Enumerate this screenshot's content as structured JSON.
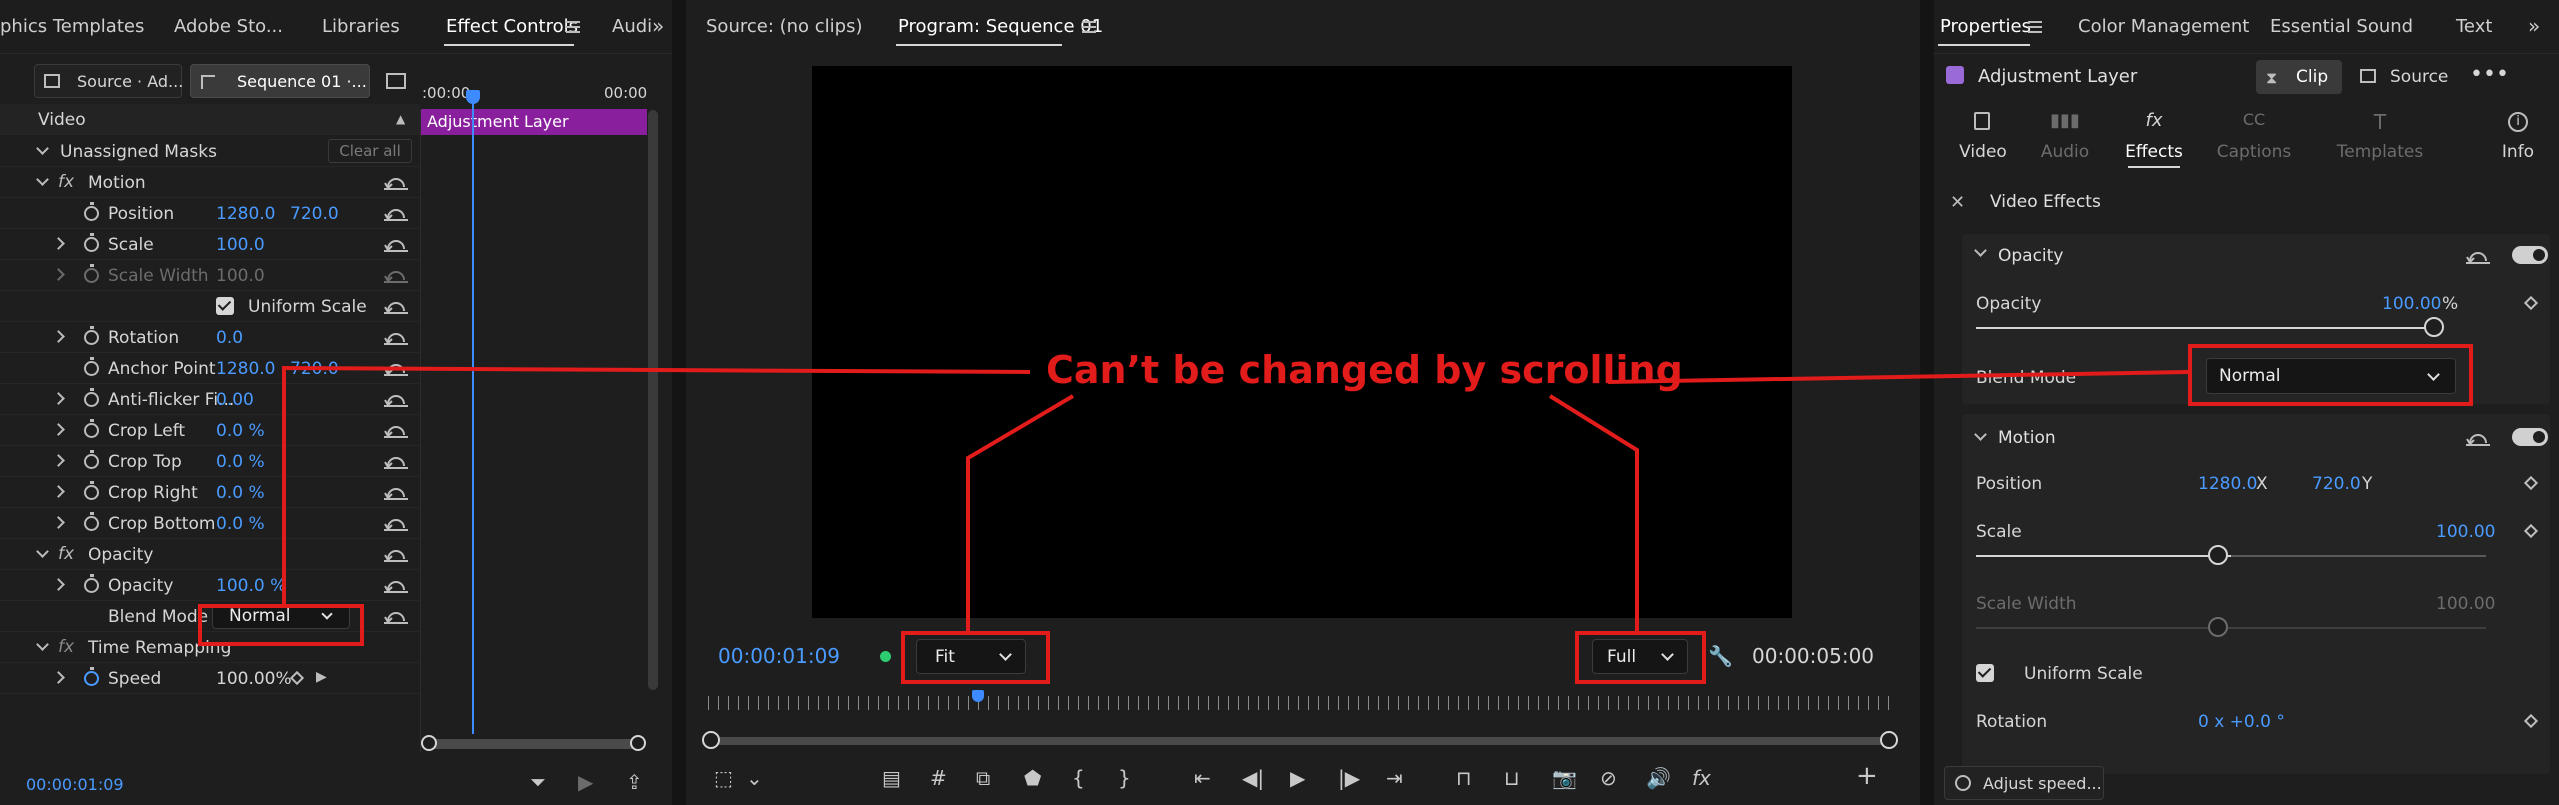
{
  "left_panel": {
    "tabs": [
      "phics Templates",
      "Adobe Sto...",
      "Libraries",
      "Effect Controls",
      "Audi"
    ],
    "source_chip": "Source · Ad...",
    "sequence_chip": "Sequence 01 ·...",
    "timeline_start": ":00:00",
    "timeline_end": "00:00",
    "clip_label": "Adjustment Layer",
    "video_header": "Video",
    "unassigned_masks": "Unassigned Masks",
    "clear_all": "Clear all",
    "motion": "Motion",
    "position": {
      "label": "Position",
      "x": "1280.0",
      "y": "720.0"
    },
    "scale": {
      "label": "Scale",
      "value": "100.0"
    },
    "scale_width": {
      "label": "Scale Width",
      "value": "100.0"
    },
    "uniform_scale": "Uniform Scale",
    "rotation": {
      "label": "Rotation",
      "value": "0.0"
    },
    "anchor_point": {
      "label": "Anchor Point",
      "x": "1280.0",
      "y": "720.0"
    },
    "anti_flicker": {
      "label": "Anti-flicker Fi...",
      "value": "0.00"
    },
    "crop_left": {
      "label": "Crop Left",
      "value": "0.0 %"
    },
    "crop_top": {
      "label": "Crop Top",
      "value": "0.0 %"
    },
    "crop_right": {
      "label": "Crop Right",
      "value": "0.0 %"
    },
    "crop_bottom": {
      "label": "Crop Bottom",
      "value": "0.0 %"
    },
    "opacity_group": "Opacity",
    "opacity": {
      "label": "Opacity",
      "value": "100.0 %"
    },
    "blend_mode": {
      "label": "Blend Mode",
      "value": "Normal"
    },
    "time_remapping": "Time Remapping",
    "speed": {
      "label": "Speed",
      "value": "100.00%"
    },
    "timecode": "00:00:01:09"
  },
  "monitor": {
    "source_tab": "Source: (no clips)",
    "program_tab": "Program: Sequence 01",
    "current_time": "00:00:01:09",
    "fit": "Fit",
    "quality": "Full",
    "duration": "00:00:05:00"
  },
  "annotation": {
    "text": "Can’t be changed by scrolling"
  },
  "right_panel": {
    "tabs": [
      "Properties",
      "Color Management",
      "Essential Sound",
      "Text"
    ],
    "title": "Adjustment Layer",
    "clip_button": "Clip",
    "source_button": "Source",
    "subtabs": [
      "Video",
      "Audio",
      "Effects",
      "Captions",
      "Templates",
      "Info"
    ],
    "video_effects": "Video Effects",
    "opacity_section": "Opacity",
    "opacity": {
      "label": "Opacity",
      "value": "100.00",
      "unit": "%"
    },
    "blend_mode": {
      "label": "Blend Mode",
      "value": "Normal"
    },
    "motion_section": "Motion",
    "position": {
      "label": "Position",
      "x": "1280.0",
      "x_axis": "X",
      "y": "720.0",
      "y_axis": "Y"
    },
    "scale": {
      "label": "Scale",
      "value": "100.00"
    },
    "scale_width": {
      "label": "Scale Width",
      "value": "100.00"
    },
    "uniform_scale": "Uniform Scale",
    "rotation": {
      "label": "Rotation",
      "value": "0 x +0.0 °"
    },
    "adjust_speed": "Adjust speed..."
  },
  "colors": {
    "accent": "#4a9bff",
    "annotation": "#e21b1b",
    "clip": "#8a1f9e",
    "playhead": "#3d8bff"
  }
}
